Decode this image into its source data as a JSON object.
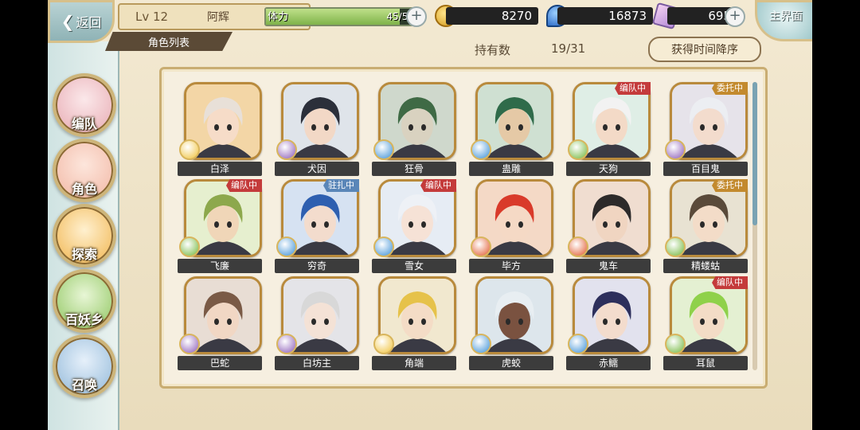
{
  "nav": {
    "back": "返回",
    "home": "主界面"
  },
  "player": {
    "level": "Lv 12",
    "name": "阿辉",
    "list_tab": "角色列表"
  },
  "stamina": {
    "label": "体力",
    "current": 45,
    "max": 51,
    "text": "45/51"
  },
  "currencies": {
    "gold": "8270",
    "soul": "16873",
    "gem": "695"
  },
  "owned": {
    "label": "持有数",
    "count": "19/31"
  },
  "sort_label": "获得时间降序",
  "sidebar": [
    {
      "label": "编队",
      "icon": "team-icon",
      "color": "#e7a9b1"
    },
    {
      "label": "角色",
      "icon": "character-icon",
      "color": "#f1b6a3"
    },
    {
      "label": "探索",
      "icon": "explore-icon",
      "color": "#f0b34a"
    },
    {
      "label": "百妖乡",
      "icon": "village-icon",
      "color": "#8bc45a"
    },
    {
      "label": "召唤",
      "icon": "summon-icon",
      "color": "#8fb7d8"
    }
  ],
  "colors": {
    "team": "#c43b3b",
    "commission": "#c38a2e",
    "station": "#5a86b8"
  },
  "characters": [
    {
      "name": "白泽",
      "element": "light",
      "status": "",
      "hair": "#e8e0d8",
      "skin": "#f6dcc8",
      "bg": "#f3d6a6"
    },
    {
      "name": "犬因",
      "element": "dark",
      "status": "",
      "hair": "#2b2f3a",
      "skin": "#f2d8c6",
      "bg": "#dfe4ea"
    },
    {
      "name": "狂骨",
      "element": "water",
      "status": "",
      "hair": "#3f6a45",
      "skin": "#d9d2c0",
      "bg": "#cfd8cc"
    },
    {
      "name": "蛊雕",
      "element": "water",
      "status": "",
      "hair": "#2f6b4a",
      "skin": "#e5c9a6",
      "bg": "#cfe0d2"
    },
    {
      "name": "天狗",
      "element": "wind",
      "status": "编队中",
      "hair": "#f2f2f2",
      "skin": "#f3dac7",
      "bg": "#dfeee6"
    },
    {
      "name": "百目鬼",
      "element": "dark",
      "status": "委托中",
      "hair": "#eceef2",
      "skin": "#f3dccd",
      "bg": "#e6e3ea"
    },
    {
      "name": "飞廉",
      "element": "wind",
      "status": "编队中",
      "hair": "#8da84c",
      "skin": "#f0d6b8",
      "bg": "#e6efcf"
    },
    {
      "name": "穷奇",
      "element": "water",
      "status": "驻扎中",
      "hair": "#2e5fb0",
      "skin": "#f3dccd",
      "bg": "#d6e2f2"
    },
    {
      "name": "雪女",
      "element": "water",
      "status": "编队中",
      "hair": "#eef1f6",
      "skin": "#f6e2d6",
      "bg": "#e6ecf4"
    },
    {
      "name": "毕方",
      "element": "fire",
      "status": "",
      "hair": "#d93a2a",
      "skin": "#f5d9c5",
      "bg": "#f4d9c6"
    },
    {
      "name": "鬼车",
      "element": "fire",
      "status": "",
      "hair": "#2d2a2a",
      "skin": "#f0d5c1",
      "bg": "#f0ddd0"
    },
    {
      "name": "精蝼蛄",
      "element": "wind",
      "status": "委托中",
      "hair": "#5a4a3a",
      "skin": "#f3dcc8",
      "bg": "#e8e2d2"
    },
    {
      "name": "巴蛇",
      "element": "dark",
      "status": "",
      "hair": "#7a5a46",
      "skin": "#f1d7c4",
      "bg": "#e8ddd4"
    },
    {
      "name": "白坊主",
      "element": "dark",
      "status": "",
      "hair": "#d8d8d8",
      "skin": "#f4e2d6",
      "bg": "#e4e4e8"
    },
    {
      "name": "角端",
      "element": "light",
      "status": "",
      "hair": "#e6c24a",
      "skin": "#f4dcc6",
      "bg": "#f1e8cf"
    },
    {
      "name": "虎蛟",
      "element": "water",
      "status": "",
      "hair": "#e8eef2",
      "skin": "#7a5240",
      "bg": "#dde6ec"
    },
    {
      "name": "赤鱬",
      "element": "water",
      "status": "",
      "hair": "#2d2f5c",
      "skin": "#f3dccd",
      "bg": "#e2e2ee"
    },
    {
      "name": "耳鼠",
      "element": "wind",
      "status": "编队中",
      "hair": "#8fd14a",
      "skin": "#f3dcc6",
      "bg": "#e4f0d2"
    }
  ]
}
